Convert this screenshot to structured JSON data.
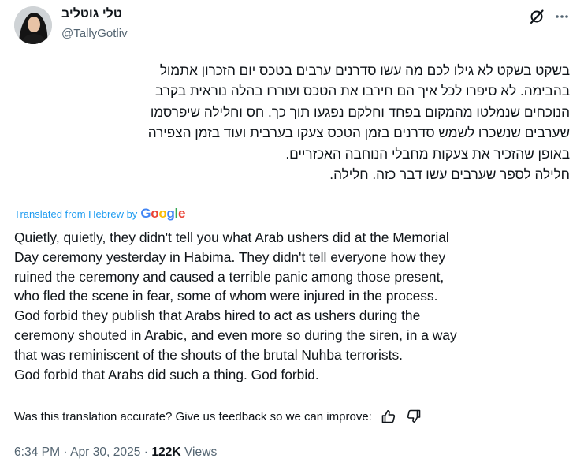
{
  "author": {
    "name": "טלי גוטליב",
    "handle": "@TallyGotliv"
  },
  "icons": {
    "grok": "grok-icon",
    "more": "more-icon",
    "thumbs_up": "thumbs-up-icon",
    "thumbs_down": "thumbs-down-icon"
  },
  "tweet": {
    "hebrew_lines": [
      "בשקט בשקט לא גילו לכם מה עשו סדרנים ערבים בטכס יום הזכרון אתמול",
      "בהבימה. לא סיפרו לכל איך הם חירבו את הטכס ועוררו בהלה נוראית בקרב",
      "הנוכחים שנמלטו מהמקום בפחד וחלקם נפגעו תוך כך. חס וחלילה שיפרסמו",
      "שערבים שנשכרו לשמש סדרנים בזמן הטכס צעקו בערבית ועוד בזמן הצפירה",
      "באופן שהזכיר את צעקות מחבלי הנוחבה האכזריים.",
      "חלילה לספר שערבים עשו דבר כזה. חלילה."
    ],
    "translated_label": "Translated from Hebrew by",
    "translator": "Google",
    "english_lines": [
      "Quietly, quietly, they didn't tell you what Arab ushers did at the Memorial",
      "Day ceremony yesterday in Habima. They didn't tell everyone how they",
      "ruined the ceremony and caused a terrible panic among those present,",
      "who fled the scene in fear, some of whom were injured in the process.",
      "God forbid they publish that Arabs hired to act as ushers during the",
      "ceremony shouted in Arabic, and even more so during the siren, in a way",
      "that was reminiscent of the shouts of the brutal Nuhba terrorists.",
      "God forbid that Arabs did such a thing. God forbid."
    ],
    "feedback_prompt": "Was this translation accurate? Give us feedback so we can improve:",
    "time": "6:34 PM",
    "date": "Apr 30, 2025",
    "views_count": "122K",
    "views_label": "Views",
    "separator": "·"
  }
}
